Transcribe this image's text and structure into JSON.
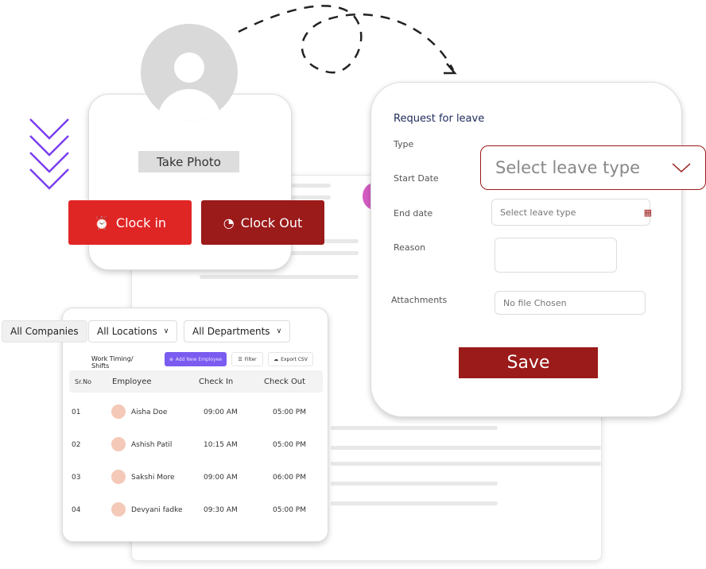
{
  "profile": {
    "take_photo": "Take Photo",
    "clock_in": "Clock in",
    "clock_out": "Clock Out"
  },
  "leave_form": {
    "title": "Request for leave",
    "type_label": "Type",
    "start_label": "Start Date",
    "end_label": "End date",
    "reason_label": "Reason",
    "attachments_label": "Attachments",
    "type_placeholder": "Select leave type",
    "end_placeholder": "Select leave type",
    "file_text": "No file Chosen",
    "save": "Save"
  },
  "filters": {
    "companies": "All Companies",
    "locations": "All Locations",
    "departments": "All Departments"
  },
  "table": {
    "title": "Work Timing/ Shifts",
    "add": "Add New Employee",
    "filter": "Filter",
    "export": "Export CSV",
    "headers": [
      "Sr.No",
      "Employee",
      "Check In",
      "Check Out"
    ],
    "rows": [
      [
        "01",
        "Aisha Doe",
        "09:00 AM",
        "05:00 PM"
      ],
      [
        "02",
        "Ashish Patil",
        "10:15 AM",
        "05:00 PM"
      ],
      [
        "03",
        "Sakshi More",
        "09:00 AM",
        "06:00 PM"
      ],
      [
        "04",
        "Devyani fadke",
        "09:30 AM",
        "05:00 PM"
      ]
    ]
  },
  "colors": {
    "red": "#e02525",
    "dark_red": "#9b1a1a",
    "purple": "#7b5cf0",
    "navy": "#1e2a5a"
  }
}
